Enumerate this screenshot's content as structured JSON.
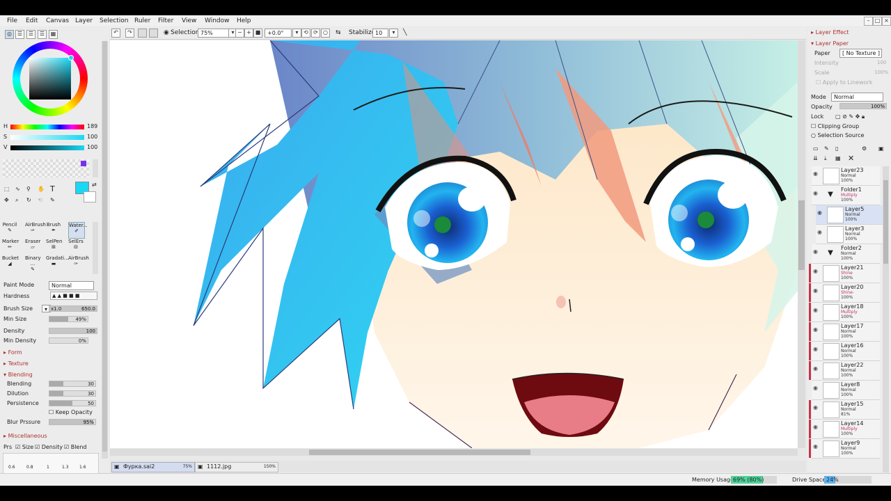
{
  "menu": [
    "File",
    "Edit",
    "Canvas",
    "Layer",
    "Selection",
    "Ruler",
    "Filter",
    "View",
    "Window",
    "Help"
  ],
  "toolbar": {
    "selection_label": "Selection",
    "zoom": "75%",
    "rotation": "+0.0°",
    "stabilizer_label": "Stabilizer",
    "stabilizer_value": "10"
  },
  "color": {
    "h_label": "H",
    "h_value": "189",
    "s_label": "S",
    "s_value": "100",
    "v_label": "V",
    "v_value": "100",
    "current_color": "#19d8f4"
  },
  "tools": {
    "pencil": "Pencil",
    "airbrush": "AirBrush",
    "brush": "Brush",
    "watercolor": "Water...",
    "marker": "Marker",
    "eraser": "Eraser",
    "selpen": "SelPen",
    "selers": "SelErs",
    "bucket": "Bucket",
    "binary": "Binary ...",
    "gradation": "Gradati...",
    "airbrush2": "AirBrush"
  },
  "brush": {
    "paint_mode_label": "Paint Mode",
    "paint_mode": "Normal",
    "hardness_label": "Hardness",
    "brush_size_label": "Brush Size",
    "brush_size_mult": "x1.0",
    "brush_size": "650.0",
    "min_size_label": "Min Size",
    "min_size": "49%",
    "density_label": "Density",
    "density": "100",
    "min_density_label": "Min Density",
    "min_density": "0%",
    "form_label": "Form",
    "texture_label": "Texture",
    "blending_section": "Blending",
    "blending_label": "Blending",
    "blending": "30",
    "dilution_label": "Dilution",
    "dilution": "30",
    "persistence_label": "Persistence",
    "persistence": "50",
    "keep_opacity_label": "Keep Opacity",
    "blur_pressure_label": "Blur Prssure",
    "blur_pressure": "95%",
    "misc_label": "Miscellaneous",
    "prs_label": "Prs",
    "size_label": "Size",
    "density_chk_label": "Density",
    "blend_label": "Blend",
    "presets": [
      "0.6",
      "0.8",
      "1",
      "1.3",
      "1.6"
    ]
  },
  "right": {
    "layer_effect": "Layer Effect",
    "layer_paper": "Layer Paper",
    "paper_label": "Paper",
    "paper_value": "[ No Texture ]",
    "intensity_label": "Intensity",
    "intensity_value": "100",
    "scale_label": "Scale",
    "scale_value": "100%",
    "apply_lineart": "Apply to Linework",
    "mode_label": "Mode",
    "mode_value": "Normal",
    "opacity_label": "Opacity",
    "opacity_value": "100%",
    "lock_label": "Lock",
    "clipping_group": "Clipping Group",
    "selection_source": "Selection Source"
  },
  "layers": [
    {
      "name": "Layer23",
      "mode": "Normal",
      "opacity": "100%"
    },
    {
      "name": "Folder1",
      "mode": "Multiply",
      "opacity": "100%"
    },
    {
      "name": "Layer5",
      "mode": "Normal",
      "opacity": "100%"
    },
    {
      "name": "Layer3",
      "mode": "Normal",
      "opacity": "100%"
    },
    {
      "name": "Folder2",
      "mode": "Normal",
      "opacity": "100%"
    },
    {
      "name": "Layer21",
      "mode": "Shine",
      "opacity": "100%"
    },
    {
      "name": "Layer20",
      "mode": "Shine-",
      "opacity": "100%"
    },
    {
      "name": "Layer18",
      "mode": "Multiply",
      "opacity": "100%"
    },
    {
      "name": "Layer17",
      "mode": "Normal",
      "opacity": "100%"
    },
    {
      "name": "Layer16",
      "mode": "Normal",
      "opacity": "100%"
    },
    {
      "name": "Layer22",
      "mode": "Normal",
      "opacity": "100%"
    },
    {
      "name": "Layer8",
      "mode": "Normal",
      "opacity": "100%"
    },
    {
      "name": "Layer15",
      "mode": "Normal",
      "opacity": "81%"
    },
    {
      "name": "Layer14",
      "mode": "Multiply",
      "opacity": "100%"
    },
    {
      "name": "Layer9",
      "mode": "Normal",
      "opacity": "100%"
    }
  ],
  "docs": [
    {
      "name": "Фурка.sai2",
      "zoom": "75%"
    },
    {
      "name": "1112.jpg",
      "zoom": "150%"
    }
  ],
  "status": {
    "memory_label": "Memory Usage",
    "memory_value": "69% (80%)",
    "memory_fraction": 0.69,
    "drive_label": "Drive Space",
    "drive_value": "24%",
    "drive_fraction": 0.24
  }
}
